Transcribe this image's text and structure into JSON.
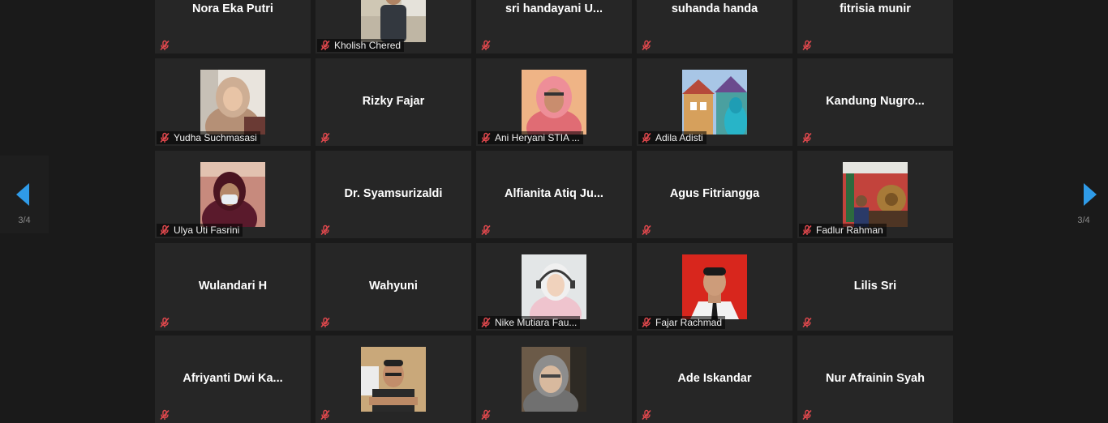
{
  "pager": {
    "current": "3/4"
  },
  "participants": [
    {
      "name": "Nora Eka Putri",
      "tile_label": "",
      "has_video": false,
      "photo": "name-only"
    },
    {
      "name": "Kholish Chered",
      "tile_label": "Kholish Chered",
      "has_video": true,
      "photo": "man-standing-indoors"
    },
    {
      "name": "sri handayani U...",
      "tile_label": "",
      "has_video": false,
      "photo": "name-only"
    },
    {
      "name": "suhanda handa",
      "tile_label": "",
      "has_video": false,
      "photo": "name-only"
    },
    {
      "name": "fitrisia munir",
      "tile_label": "",
      "has_video": false,
      "photo": "name-only"
    },
    {
      "name": "Yudha Suchmasasi",
      "tile_label": "Yudha Suchmasasi",
      "has_video": true,
      "photo": "woman-cream-hijab"
    },
    {
      "name": "Rizky Fajar",
      "tile_label": "",
      "has_video": false,
      "photo": "name-only"
    },
    {
      "name": "Ani Heryani STIA ...",
      "tile_label": "Ani Heryani STIA ...",
      "has_video": true,
      "photo": "woman-pink-hijab"
    },
    {
      "name": "Adila Adisti",
      "tile_label": "Adila Adisti",
      "has_video": true,
      "photo": "woman-colorful-village"
    },
    {
      "name": "Kandung  Nugro...",
      "tile_label": "",
      "has_video": false,
      "photo": "name-only"
    },
    {
      "name": "Ulya Uti Fasrini",
      "tile_label": "Ulya Uti Fasrini",
      "has_video": true,
      "photo": "woman-mask-hijab"
    },
    {
      "name": "Dr. Syamsurizaldi",
      "tile_label": "",
      "has_video": false,
      "photo": "name-only"
    },
    {
      "name": "Alfianita Atiq Ju...",
      "tile_label": "",
      "has_video": false,
      "photo": "name-only"
    },
    {
      "name": "Agus Fitriangga",
      "tile_label": "",
      "has_video": false,
      "photo": "name-only"
    },
    {
      "name": "Fadlur Rahman",
      "tile_label": "Fadlur Rahman",
      "has_video": true,
      "photo": "man-gamelan-room"
    },
    {
      "name": "Wulandari H",
      "tile_label": "",
      "has_video": false,
      "photo": "name-only"
    },
    {
      "name": "Wahyuni",
      "tile_label": "",
      "has_video": false,
      "photo": "name-only"
    },
    {
      "name": "Nike Mutiara Fau...",
      "tile_label": "Nike Mutiara Fau...",
      "has_video": true,
      "photo": "woman-headset"
    },
    {
      "name": "Fajar Rachmad",
      "tile_label": "Fajar Rachmad",
      "has_video": true,
      "photo": "man-formal-red-bg"
    },
    {
      "name": "Lilis Sri",
      "tile_label": "",
      "has_video": false,
      "photo": "name-only"
    },
    {
      "name": "Afriyanti  Dwi  Ka...",
      "tile_label": "",
      "has_video": false,
      "photo": "name-only"
    },
    {
      "name": "",
      "tile_label": "",
      "has_video": true,
      "photo": "man-glasses-arms-crossed"
    },
    {
      "name": "",
      "tile_label": "",
      "has_video": true,
      "photo": "woman-grey-hijab"
    },
    {
      "name": "Ade Iskandar",
      "tile_label": "",
      "has_video": false,
      "photo": "name-only"
    },
    {
      "name": "Nur Afrainin Syah",
      "tile_label": "",
      "has_video": false,
      "photo": "name-only"
    }
  ],
  "colors": {
    "background": "#1a1a1a",
    "tile": "#262626",
    "accent": "#2f9be8",
    "muted_icon": "#e0484d"
  },
  "icons": {
    "mute": "mic-muted-icon",
    "prev": "chevron-left-icon",
    "next": "chevron-right-icon"
  }
}
